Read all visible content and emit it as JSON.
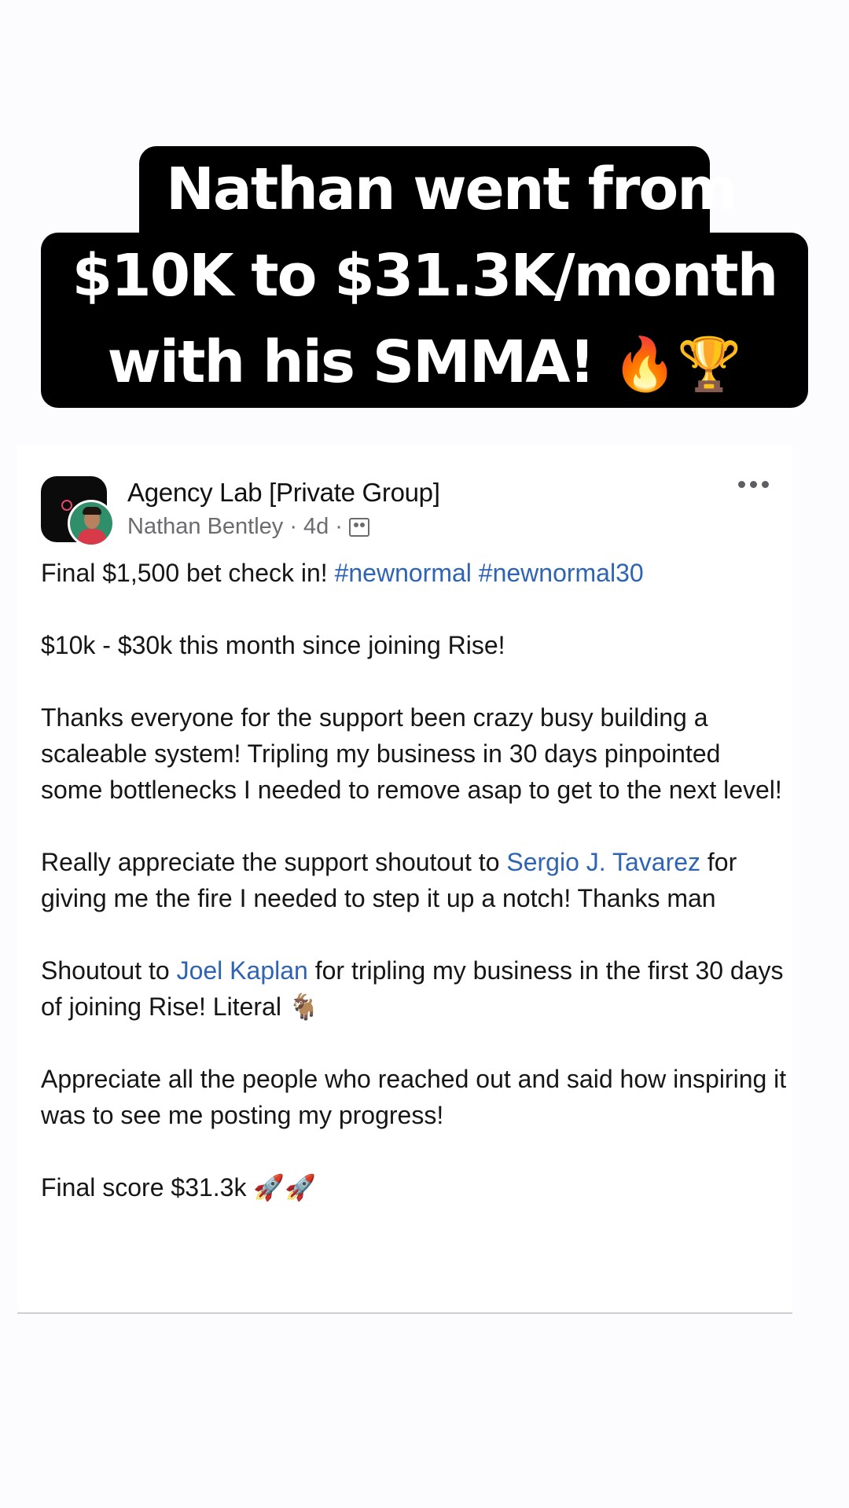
{
  "headline": {
    "line1": "Nathan went from",
    "line2": "$10K to $31.3K/month",
    "line3": "with his SMMA!",
    "emojis": "🔥🏆"
  },
  "post": {
    "group_name": "Agency Lab [Private Group]",
    "author": "Nathan Bentley",
    "time": "4d",
    "paragraphs": {
      "p1_text": "Final $1,500 bet check in!",
      "p1_tag1": "#newnormal",
      "p1_tag2": "#newnormal30",
      "p2": "$10k - $30k this month since joining Rise!",
      "p3": "Thanks everyone for the support been crazy busy building a scaleable system! Tripling my business in 30 days pinpointed some bottlenecks I needed to remove asap to get to the next level!",
      "p4_before": "Really appreciate the support shoutout to",
      "p4_mention": "Sergio J. Tavarez",
      "p4_after": "for giving me the fire I needed to step it up a notch! Thanks man",
      "p5_before": "Shoutout to",
      "p5_mention": "Joel Kaplan",
      "p5_after": "for tripling my business in the first 30 days of joining Rise! Literal 🐐",
      "p6": "Appreciate all the people who reached out and said how inspiring it was to see me posting my progress!",
      "p7": "Final score $31.3k 🚀🚀"
    }
  },
  "colors": {
    "link": "#2e64b3",
    "caption_bg": "#000000",
    "meta_text": "#6b6b70"
  },
  "icons": [
    "more-options-icon",
    "group-privacy-icon"
  ]
}
